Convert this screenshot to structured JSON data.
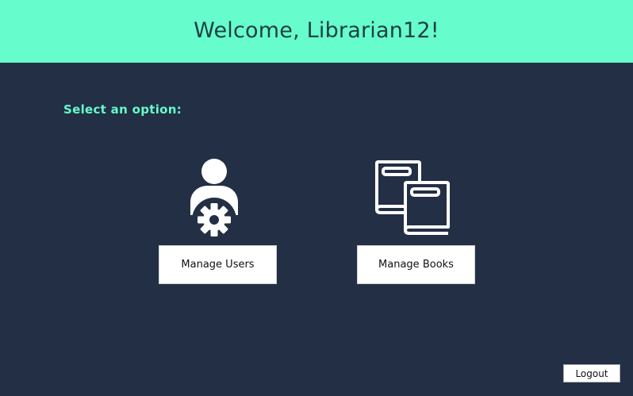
{
  "header": {
    "title": "Welcome, Librarian12!",
    "background": "#66fccb"
  },
  "main": {
    "prompt": "Select an option:",
    "background": "#232f45",
    "accent": "#66fccb",
    "options": [
      {
        "icon": "user-gear-icon",
        "label": "Manage Users"
      },
      {
        "icon": "books-icon",
        "label": "Manage Books"
      }
    ]
  },
  "footer": {
    "logout_label": "Logout"
  }
}
